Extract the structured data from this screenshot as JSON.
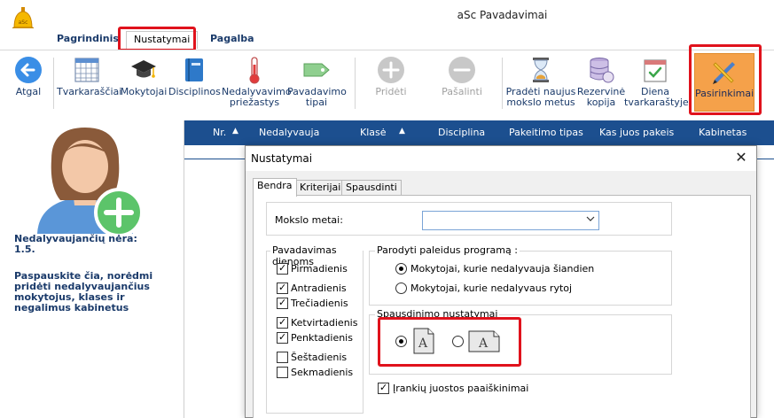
{
  "window": {
    "title": "aSc Pavadavimai"
  },
  "menu": {
    "tabs": [
      {
        "label": "Pagrindinis"
      },
      {
        "label": "Nustatymai"
      },
      {
        "label": "Pagalba"
      }
    ]
  },
  "ribbon": {
    "back": "Atgal",
    "timetables": "Tvarkaraščiai",
    "teachers": "Mokytojai",
    "subjects": "Disciplinos",
    "absence_reasons_l1": "Nedalyvavimo",
    "absence_reasons_l2": "priežastys",
    "substitution_types_l1": "Pavadavimo",
    "substitution_types_l2": "tipai",
    "add": "Pridėti",
    "remove": "Pašalinti",
    "new_year_l1": "Pradėti naujus",
    "new_year_l2": "mokslo metus",
    "backup_l1": "Rezervinė",
    "backup_l2": "kopija",
    "daily_l1": "Diena",
    "daily_l2": "tvarkaraštyje",
    "options": "Pasirinkimai"
  },
  "left_panel": {
    "status_l1": "Nedalyvaujančių nėra:",
    "status_l2": "1.5.",
    "hint_l1": "Paspauskite čia, norėdmi",
    "hint_l2": "pridėti nedalyvaujančius",
    "hint_l3": "mokytojus, klases ir",
    "hint_l4": "negalimus kabinetus"
  },
  "grid": {
    "columns": [
      {
        "label": "Nr."
      },
      {
        "label": "Nedalyvauja"
      },
      {
        "label": "Klasė"
      },
      {
        "label": "Disciplina"
      },
      {
        "label": "Pakeitimo tipas"
      },
      {
        "label": "Kas juos pakeis"
      },
      {
        "label": "Kabinetas"
      }
    ]
  },
  "dialog": {
    "title": "Nustatymai",
    "close": "✕",
    "tabs": [
      {
        "label": "Bendra"
      },
      {
        "label": "Kriterijai"
      },
      {
        "label": "Spausdinti"
      }
    ],
    "school_year_label": "Mokslo metai:",
    "school_year_value": "",
    "days_group": "Pavadavimas dienoms",
    "days": [
      {
        "label": "Pirmadienis",
        "checked": true
      },
      {
        "label": "Antradienis",
        "checked": true
      },
      {
        "label": "Trečiadienis",
        "checked": true
      },
      {
        "label": "Ketvirtadienis",
        "checked": true
      },
      {
        "label": "Penktadienis",
        "checked": true
      },
      {
        "label": "Šeštadienis",
        "checked": false
      },
      {
        "label": "Sekmadienis",
        "checked": false
      }
    ],
    "show_group": "Parodyti paleidus programą :",
    "show_opt1": "Mokytojai, kurie nedalyvauja šiandien",
    "show_opt2": "Mokytojai, kurie nedalyvaus rytoj",
    "print_group": "Spausdinimo nustatymai",
    "page_letter": "A",
    "toolbar_hints": "Įrankių juostos paaiškinimai",
    "check_mark": "✓"
  }
}
